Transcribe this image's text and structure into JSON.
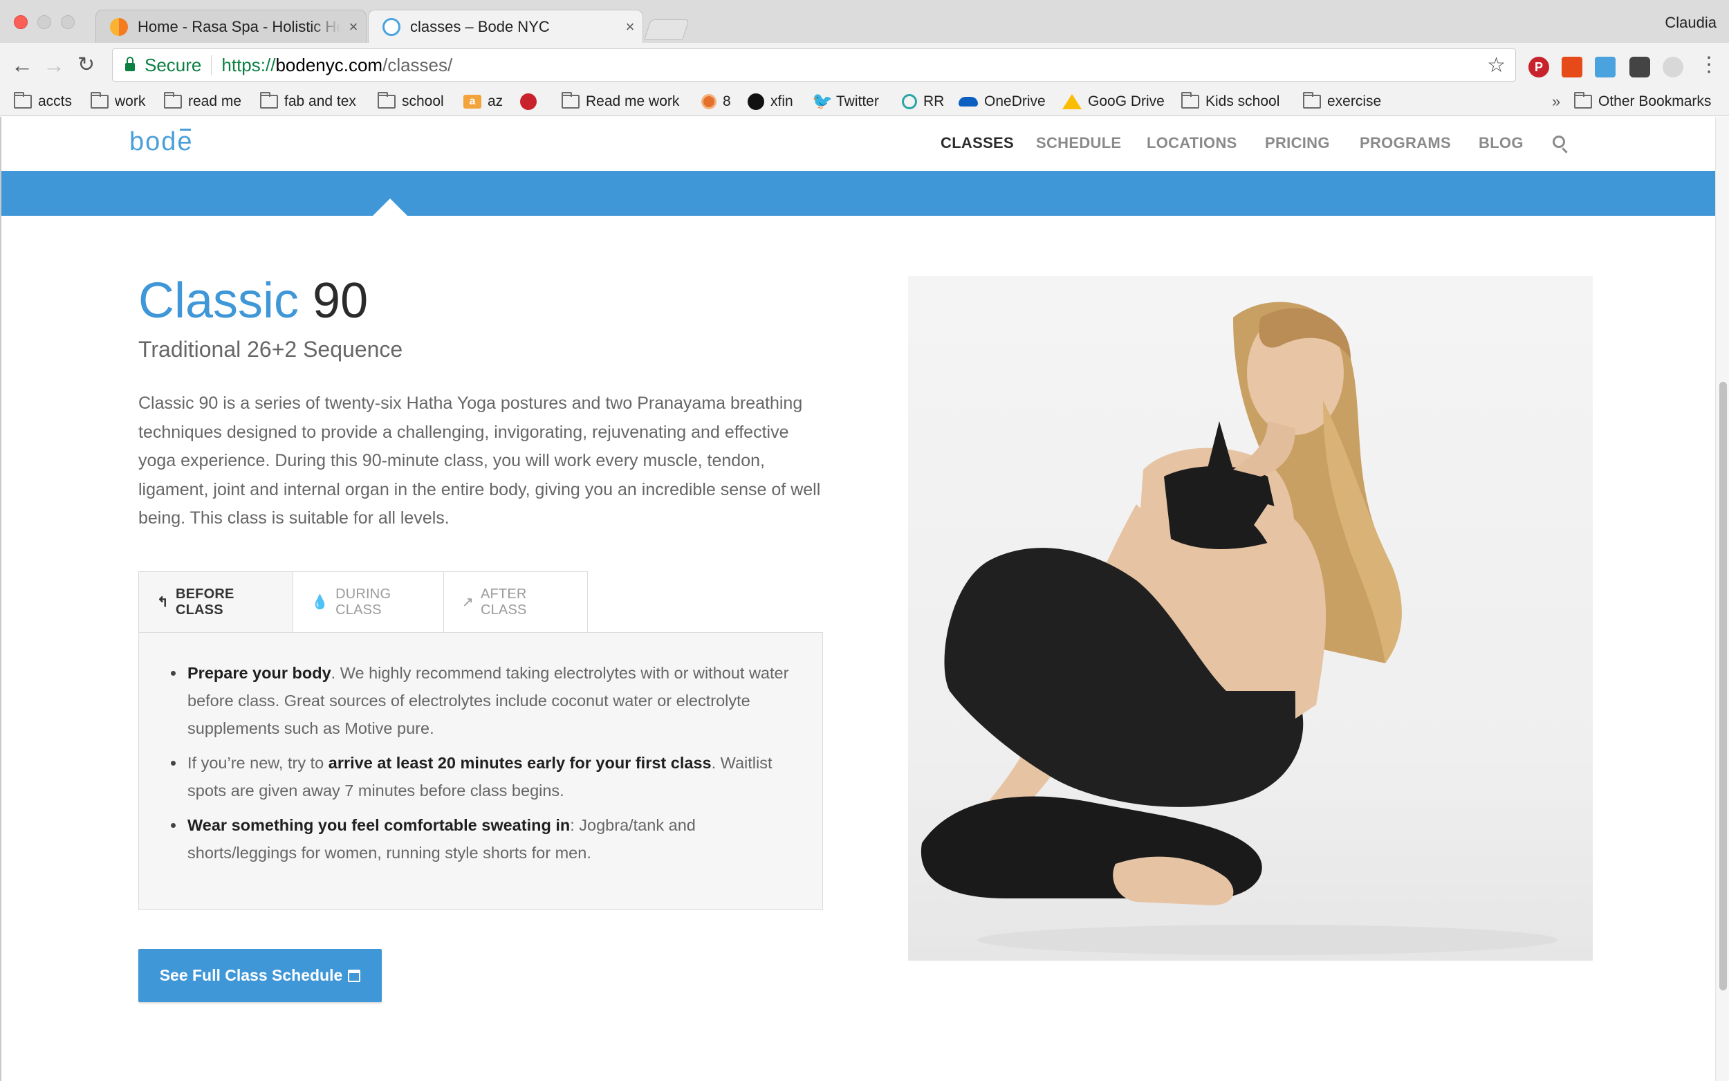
{
  "browser": {
    "tabs": [
      {
        "title": "Home - Rasa Spa - Holistic Health",
        "close": "×"
      },
      {
        "title": "classes – Bode NYC",
        "close": "×"
      }
    ],
    "profile": "Claudia",
    "address": {
      "secure_label": "Secure",
      "scheme": "https://",
      "host": "bodenyc.com",
      "path": "/classes/"
    },
    "bookmarks": [
      {
        "label": "accts",
        "icon": "folder-icon"
      },
      {
        "label": "work",
        "icon": "folder-icon"
      },
      {
        "label": "read me",
        "icon": "folder-icon"
      },
      {
        "label": "fab and tex",
        "icon": "folder-icon"
      },
      {
        "label": "school",
        "icon": "folder-icon"
      },
      {
        "label": "az",
        "icon": "amazon-icon"
      },
      {
        "label": "",
        "icon": "pinterest-icon"
      },
      {
        "label": "Read me work",
        "icon": "folder-icon"
      },
      {
        "label": "8",
        "icon": "badge-icon"
      },
      {
        "label": "xfin",
        "icon": "xfinity-icon"
      },
      {
        "label": "Twitter",
        "icon": "twitter-icon"
      },
      {
        "label": "RR",
        "icon": "rr-icon"
      },
      {
        "label": "OneDrive",
        "icon": "onedrive-icon"
      },
      {
        "label": "GooG Drive",
        "icon": "google-drive-icon"
      },
      {
        "label": "Kids school",
        "icon": "folder-icon"
      },
      {
        "label": "exercise",
        "icon": "folder-icon"
      }
    ],
    "overflow": "»",
    "other_bookmarks": "Other Bookmarks"
  },
  "site": {
    "logo": {
      "pre": "bod",
      "mac": "e"
    },
    "nav": [
      "CLASSES",
      "SCHEDULE",
      "LOCATIONS",
      "PRICING",
      "PROGRAMS",
      "BLOG"
    ],
    "active_nav": "CLASSES",
    "accent_color": "#3f97d8"
  },
  "class": {
    "title_main": "Classic",
    "title_accent": "90",
    "subtitle": "Traditional 26+2 Sequence",
    "description": "Classic 90 is a series of twenty-six Hatha Yoga postures and two Pranayama breathing techniques designed to provide a challenging, invigorating, rejuvenating and effective yoga experience. During this 90-minute class, you will work every muscle, tendon, ligament, joint and internal organ in the entire body, giving you an incredible sense of well being. This class is suitable for all levels.",
    "tabs": [
      {
        "label": "BEFORE CLASS",
        "icon": "arrow-back-icon"
      },
      {
        "label": "DURING CLASS",
        "icon": "drop-icon"
      },
      {
        "label": "AFTER CLASS",
        "icon": "arrow-forward-icon"
      }
    ],
    "bullets": [
      {
        "pre": "",
        "bold": "Prepare your body",
        "post": ". We highly recommend taking electrolytes with or without water before class. Great sources of electrolytes include coconut water or electrolyte supplements such as Motive pure."
      },
      {
        "pre": "If you’re new, try to ",
        "bold": "arrive at least 20 minutes early for your first class",
        "post": ". Waitlist spots are given away 7 minutes before class begins."
      },
      {
        "pre": "",
        "bold": "Wear something you feel comfortable sweating in",
        "post": ": Jogbra/tank and shorts/leggings for women, running style shorts for men."
      }
    ],
    "cta": "See Full Class Schedule"
  }
}
